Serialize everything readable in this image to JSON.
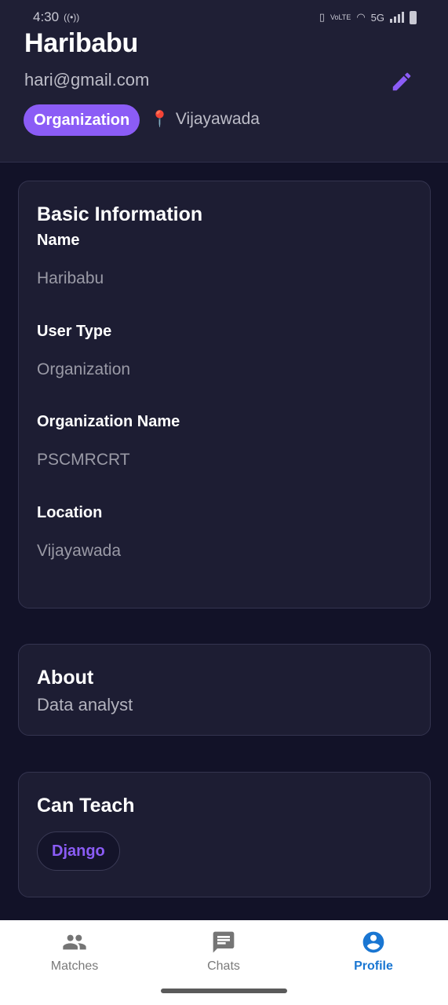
{
  "status_bar": {
    "time": "4:30",
    "network": "5G"
  },
  "profile": {
    "name": "Haribabu",
    "email": "hari@gmail.com",
    "role": "Organization",
    "location": "Vijayawada"
  },
  "basic_info": {
    "title": "Basic Information",
    "fields": [
      {
        "label": "Name",
        "value": "Haribabu"
      },
      {
        "label": "User Type",
        "value": "Organization"
      },
      {
        "label": "Organization Name",
        "value": "PSCMRCRT"
      },
      {
        "label": "Location",
        "value": "Vijayawada"
      }
    ]
  },
  "about": {
    "title": "About",
    "text": "Data analyst"
  },
  "can_teach": {
    "title": "Can Teach",
    "skills": [
      "Django"
    ]
  },
  "nav": {
    "items": [
      {
        "label": "Matches",
        "icon": "people-icon"
      },
      {
        "label": "Chats",
        "icon": "chat-icon"
      },
      {
        "label": "Profile",
        "icon": "account-circle-icon"
      }
    ],
    "active": "Profile"
  },
  "colors": {
    "accent": "#8b5cf6",
    "nav_active": "#1976d2",
    "background": "#121228"
  }
}
